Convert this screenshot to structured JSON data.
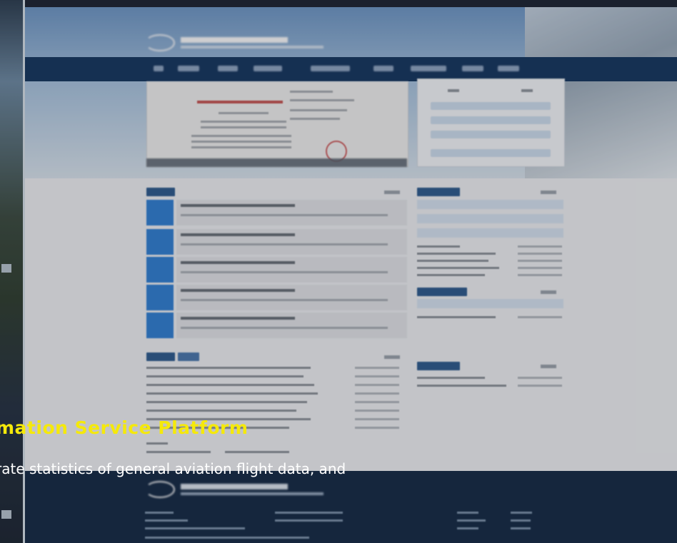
{
  "caption": {
    "title": "mation Service Platform",
    "subtitle": "rate statistics of general aviation flight data, and"
  },
  "colors": {
    "caption_title": "#f5e90a",
    "caption_subtitle": "#ffffff",
    "nav_bar": "#13355e",
    "accent_blue": "#2f7fd4",
    "footer": "#122843"
  }
}
